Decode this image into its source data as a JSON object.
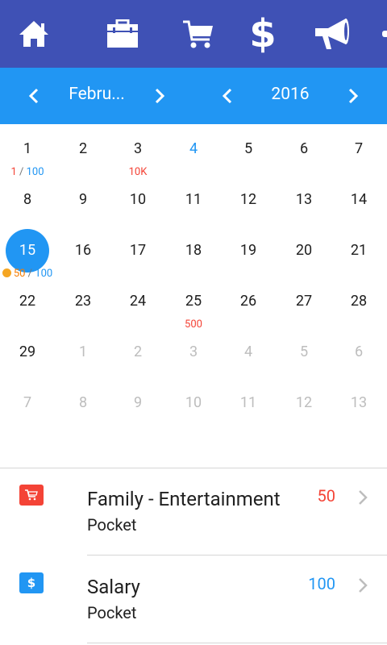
{
  "toolbar": {
    "icons": [
      "home-icon",
      "briefcase-icon",
      "cart-icon",
      "dollar-icon",
      "megaphone-icon"
    ],
    "dollar_glyph": "$",
    "bg_color": "#3f51b5"
  },
  "navigator": {
    "month": "Febru...",
    "year": "2016",
    "bg_color": "#2196f3"
  },
  "calendar": {
    "selected_day": "15",
    "weeks": [
      [
        {
          "day": "1",
          "sub_a": "1",
          "sep": " / ",
          "sub_b": "100"
        },
        {
          "day": "2"
        },
        {
          "day": "3",
          "sub_a": "10K"
        },
        {
          "day": "4",
          "highlight": true
        },
        {
          "day": "5"
        },
        {
          "day": "6"
        },
        {
          "day": "7"
        }
      ],
      [
        {
          "day": "8"
        },
        {
          "day": "9"
        },
        {
          "day": "10"
        },
        {
          "day": "11"
        },
        {
          "day": "12"
        },
        {
          "day": "13"
        },
        {
          "day": "14"
        }
      ],
      [
        {
          "day": "15",
          "selected": true,
          "alarm": true,
          "sub_a": "50",
          "sep": " / ",
          "sub_b": "100"
        },
        {
          "day": "16"
        },
        {
          "day": "17"
        },
        {
          "day": "18"
        },
        {
          "day": "19"
        },
        {
          "day": "20"
        },
        {
          "day": "21"
        }
      ],
      [
        {
          "day": "22"
        },
        {
          "day": "23"
        },
        {
          "day": "24"
        },
        {
          "day": "25",
          "sub_a": "500"
        },
        {
          "day": "26"
        },
        {
          "day": "27"
        },
        {
          "day": "28"
        }
      ],
      [
        {
          "day": "29"
        },
        {
          "day": "1",
          "out": true
        },
        {
          "day": "2",
          "out": true
        },
        {
          "day": "3",
          "out": true
        },
        {
          "day": "4",
          "out": true
        },
        {
          "day": "5",
          "out": true
        },
        {
          "day": "6",
          "out": true
        }
      ],
      [
        {
          "day": "7",
          "out": true
        },
        {
          "day": "8",
          "out": true
        },
        {
          "day": "9",
          "out": true
        },
        {
          "day": "10",
          "out": true
        },
        {
          "day": "11",
          "out": true
        },
        {
          "day": "12",
          "out": true
        },
        {
          "day": "13",
          "out": true
        }
      ]
    ]
  },
  "transactions": [
    {
      "icon": "cart-icon",
      "category": "Family - Entertainment",
      "account": "Pocket",
      "amount": "50",
      "type": "expense",
      "color": "#f44336"
    },
    {
      "icon": "dollar-icon",
      "category": "Salary",
      "account": "Pocket",
      "amount": "100",
      "type": "income",
      "color": "#2196f3"
    }
  ]
}
